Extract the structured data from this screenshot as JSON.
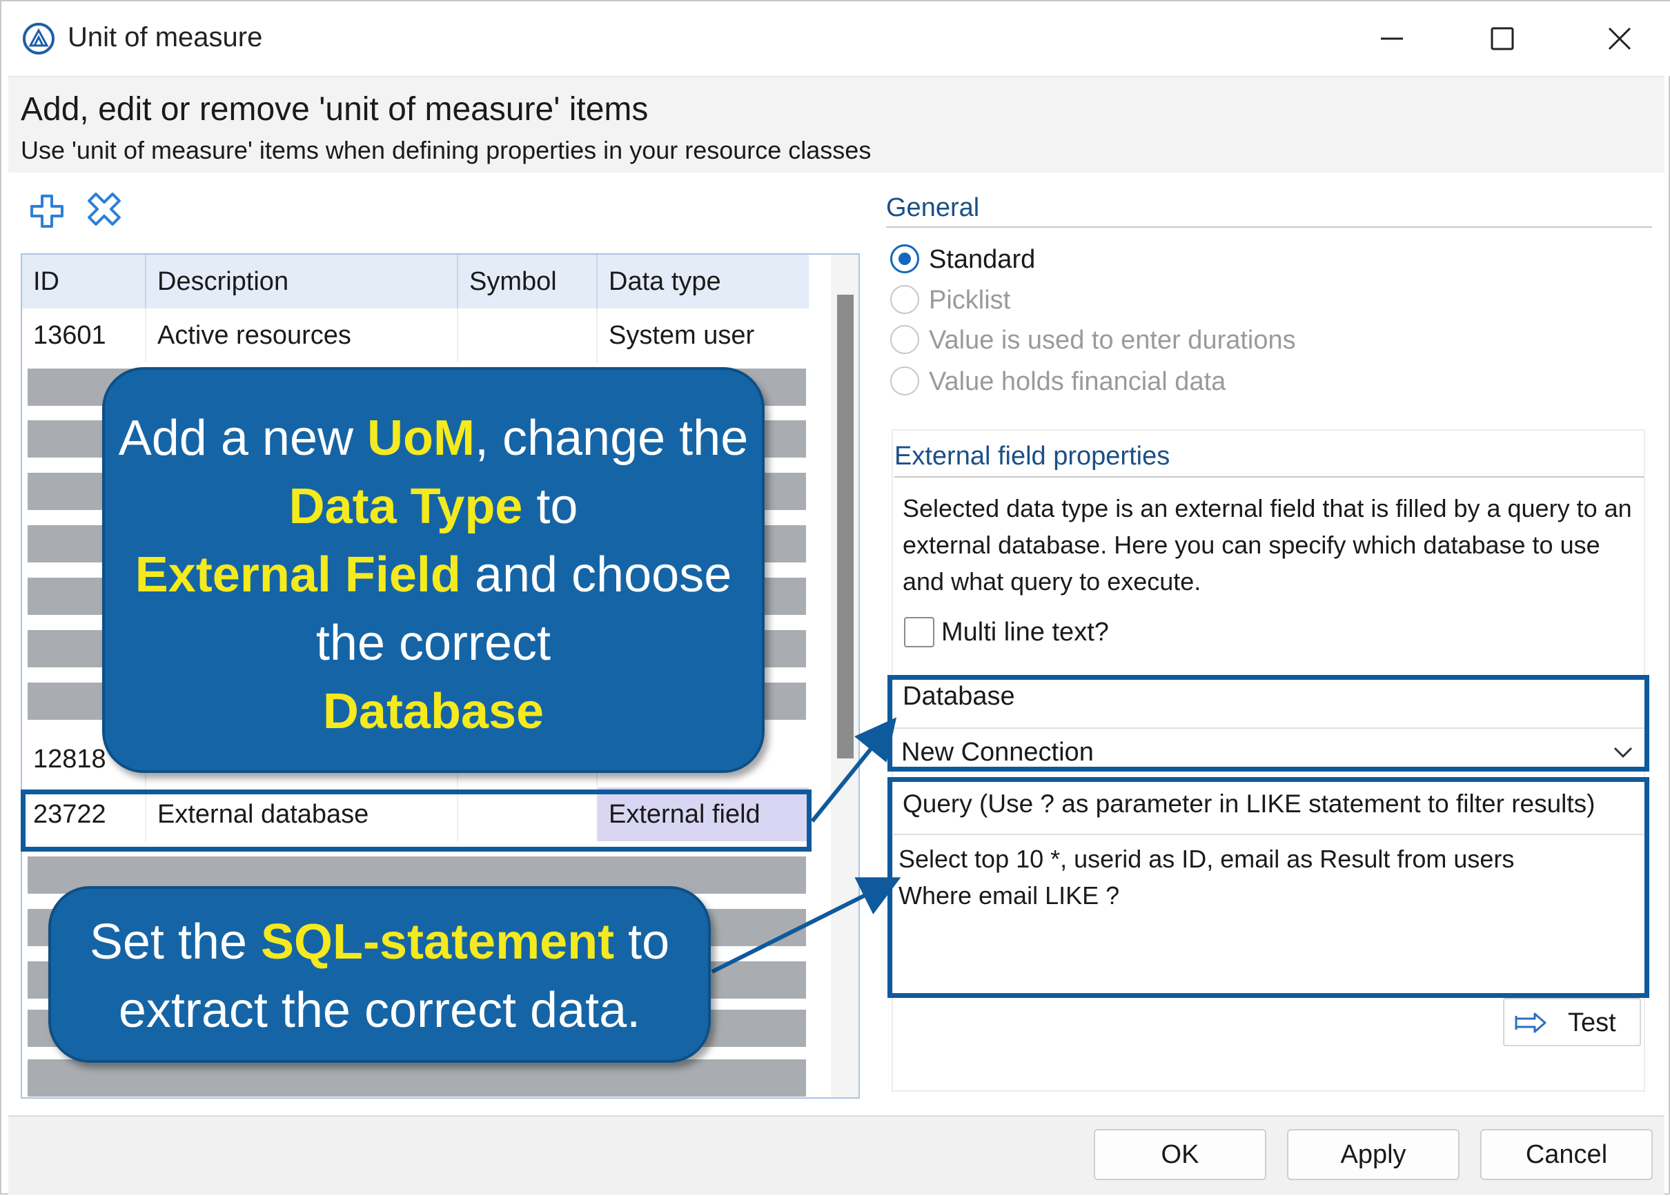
{
  "window": {
    "title": "Unit of measure"
  },
  "header": {
    "title": "Add, edit or remove 'unit of measure' items",
    "subtitle": "Use 'unit of measure' items when defining properties in your resource classes"
  },
  "toolbar": {
    "add_icon": "plus-icon",
    "remove_icon": "remove-x-icon"
  },
  "grid": {
    "columns": [
      "ID",
      "Description",
      "Symbol",
      "Data type"
    ],
    "rows": [
      {
        "id": "13601",
        "description": "Active resources",
        "symbol": "",
        "data_type": "System user"
      },
      {
        "id": "12818",
        "description": "",
        "symbol": "",
        "data_type": ""
      },
      {
        "id": "23722",
        "description": "External database",
        "symbol": "",
        "data_type": "External field"
      }
    ]
  },
  "general": {
    "header": "General",
    "options": [
      {
        "label": "Standard",
        "checked": true,
        "enabled": true
      },
      {
        "label": "Picklist",
        "checked": false,
        "enabled": false
      },
      {
        "label": "Value is used to enter durations",
        "checked": false,
        "enabled": false
      },
      {
        "label": "Value holds financial data",
        "checked": false,
        "enabled": false
      }
    ]
  },
  "external": {
    "header": "External field properties",
    "description": "Selected data type is an external field that is filled by a query to an external database. Here you can specify which database to use and what query to execute.",
    "multiline_label": "Multi line text?",
    "database_label": "Database",
    "database_value": "New Connection",
    "query_label": "Query (Use ? as parameter in LIKE statement to filter results)",
    "query_text": "Select top 10 *, userid as ID, email as Result from users\nWhere email LIKE ?",
    "test_label": "Test"
  },
  "buttons": {
    "ok": "OK",
    "apply": "Apply",
    "cancel": "Cancel"
  },
  "callouts": {
    "top": {
      "part1": "Add a new ",
      "em1": "UoM",
      "part2": ", change the ",
      "em2": "Data Type",
      "part3": " to ",
      "em3": "External Field",
      "part4": " and choose the correct ",
      "em4": "Database"
    },
    "bottom": {
      "part1": "Set the ",
      "em1": "SQL-statement",
      "part2": " to extract the correct data."
    }
  },
  "colors": {
    "accent": "#1565a6",
    "highlight": "#f5ea1d",
    "section_header": "#1b4f88",
    "selected_cell": "#d9d6f3"
  }
}
